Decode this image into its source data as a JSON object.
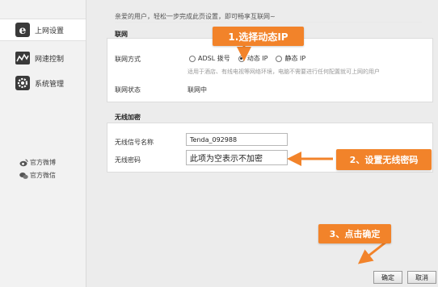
{
  "sidebar": {
    "items": [
      {
        "label": "上网设置",
        "icon": "internet-e-icon"
      },
      {
        "label": "网速控制",
        "icon": "speed-graph-icon"
      },
      {
        "label": "系统管理",
        "icon": "gear-icon"
      }
    ],
    "social": [
      {
        "label": "官方微博",
        "icon": "weibo-icon"
      },
      {
        "label": "官方微信",
        "icon": "wechat-icon"
      }
    ]
  },
  "welcome": "亲爱的用户，轻松一步完成此页设置，即可畅享互联网~",
  "network": {
    "title": "联网",
    "mode_label": "联网方式",
    "options": [
      "ADSL 拨号",
      "动态 IP",
      "静态 IP"
    ],
    "selected": "动态 IP",
    "hint": "适用于酒店、有线电视等网络环境，电脑不需要进行任何配置就可上网的用户",
    "status_label": "联网状态",
    "status_value": "联网中"
  },
  "wireless": {
    "title": "无线加密",
    "ssid_label": "无线信号名称",
    "ssid_value": "Tenda_092988",
    "password_label": "无线密码",
    "password_placeholder": "此项为空表示不加密"
  },
  "annotations": {
    "step1": "1.选择动态IP",
    "step2": "2、设置无线密码",
    "step3": "3、点击确定"
  },
  "buttons": {
    "ok": "确定",
    "cancel": "取消"
  },
  "colors": {
    "callout": "#f2832a",
    "arrow": "#f2832a"
  }
}
